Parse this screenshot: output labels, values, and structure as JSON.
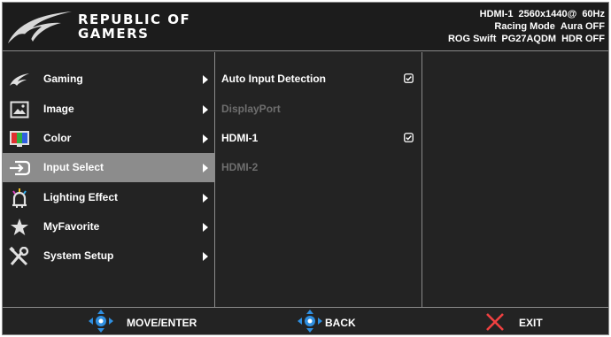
{
  "header": {
    "brand_line1": "REPUBLIC OF",
    "brand_line2": "GAMERS",
    "status": {
      "input": "HDMI-1",
      "resolution": "2560x1440@",
      "refresh": "60Hz",
      "mode": "Racing Mode",
      "aura": "Aura OFF",
      "model": "ROG Swift",
      "model_number": "PG27AQDM",
      "hdr": "HDR OFF"
    }
  },
  "menu": {
    "items": [
      {
        "label": "Gaming",
        "icon": "rog-eye-icon"
      },
      {
        "label": "Image",
        "icon": "image-icon"
      },
      {
        "label": "Color",
        "icon": "color-icon"
      },
      {
        "label": "Input Select",
        "icon": "input-icon",
        "selected": true
      },
      {
        "label": "Lighting Effect",
        "icon": "lighting-icon"
      },
      {
        "label": "MyFavorite",
        "icon": "star-icon"
      },
      {
        "label": "System Setup",
        "icon": "tools-icon"
      }
    ]
  },
  "submenu": {
    "items": [
      {
        "label": "Auto Input Detection",
        "checked": true,
        "enabled": true
      },
      {
        "label": "DisplayPort",
        "checked": false,
        "enabled": false
      },
      {
        "label": "HDMI-1",
        "checked": true,
        "enabled": true
      },
      {
        "label": "HDMI-2",
        "checked": false,
        "enabled": false
      }
    ]
  },
  "footer": {
    "move_label": "MOVE/ENTER",
    "back_label": "BACK",
    "exit_label": "EXIT"
  },
  "colors": {
    "panel": "#232323",
    "selected": "#8c8c8c",
    "disabled_text": "#6e6e6e",
    "border": "#8a8a8a",
    "dpad_blue": "#2f8fe0"
  }
}
